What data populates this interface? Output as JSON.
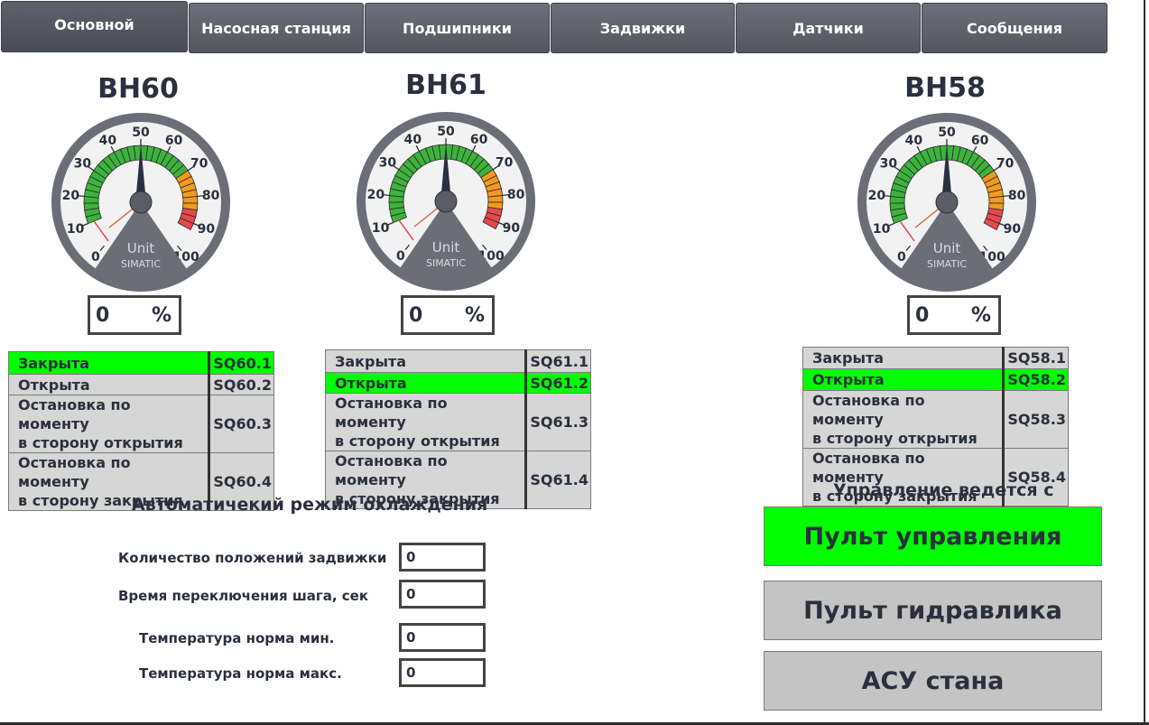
{
  "tabs": [
    {
      "label": "Основной",
      "active": true
    },
    {
      "label": "Насосная станция",
      "active": false
    },
    {
      "label": "Подшипники",
      "active": false
    },
    {
      "label": "Задвижки",
      "active": false
    },
    {
      "label": "Датчики",
      "active": false
    },
    {
      "label": "Сообщения",
      "active": false
    }
  ],
  "gauge_scale": {
    "ticks": [
      "0",
      "10",
      "20",
      "30",
      "40",
      "50",
      "60",
      "70",
      "80",
      "90",
      "100"
    ],
    "unit": "Unit",
    "brand": "SIMATIC",
    "colors": {
      "green": "#3db33d",
      "orange": "#f39a1e",
      "red": "#e8474f",
      "face": "#f2f2f2",
      "rim": "#6b6d77"
    }
  },
  "valves": [
    {
      "name": "BH60",
      "gauge_value": 50,
      "percent_value": "0",
      "percent_unit": "%",
      "states": [
        {
          "label": "Закрыта",
          "code": "SQ60.1",
          "active": true
        },
        {
          "label": "Открыта",
          "code": "SQ60.2",
          "active": false
        },
        {
          "label1": "Остановка по моменту",
          "label2": "в сторону открытия",
          "code": "SQ60.3",
          "active": false
        },
        {
          "label1": "Остановка по моменту",
          "label2": "в сторону закрытия",
          "code": "SQ60.4",
          "active": false
        }
      ]
    },
    {
      "name": "BH61",
      "gauge_value": 50,
      "percent_value": "0",
      "percent_unit": "%",
      "states": [
        {
          "label": "Закрыта",
          "code": "SQ61.1",
          "active": false
        },
        {
          "label": "Открыта",
          "code": "SQ61.2",
          "active": true
        },
        {
          "label1": "Остановка по моменту",
          "label2": "в сторону открытия",
          "code": "SQ61.3",
          "active": false
        },
        {
          "label1": "Остановка по моменту",
          "label2": "в сторону закрытия",
          "code": "SQ61.4",
          "active": false
        }
      ]
    },
    {
      "name": "BH58",
      "gauge_value": 50,
      "percent_value": "0",
      "percent_unit": "%",
      "states": [
        {
          "label": "Закрыта",
          "code": "SQ58.1",
          "active": false
        },
        {
          "label": "Открыта",
          "code": "SQ58.2",
          "active": true
        },
        {
          "label1": "Остановка по моменту",
          "label2": "в сторону открытия",
          "code": "SQ58.3",
          "active": false
        },
        {
          "label1": "Остановка по моменту",
          "label2": "в сторону закрытия",
          "code": "SQ58.4",
          "active": false
        }
      ]
    }
  ],
  "auto_cooling": {
    "title": "Автоматичекий режим охлаждения",
    "fields": [
      {
        "label": "Количество положений задвижки",
        "value": "0"
      },
      {
        "label": "Время переключения шага, сек",
        "value": "0"
      },
      {
        "label": "Температура норма мин.",
        "value": "0"
      },
      {
        "label": "Температура норма макс.",
        "value": "0"
      }
    ]
  },
  "control": {
    "title": "Управление ведется с",
    "buttons": [
      {
        "label": "Пульт управления",
        "active": true
      },
      {
        "label": "Пульт гидравлика",
        "active": false
      },
      {
        "label": "АСУ стана",
        "active": false
      }
    ]
  }
}
